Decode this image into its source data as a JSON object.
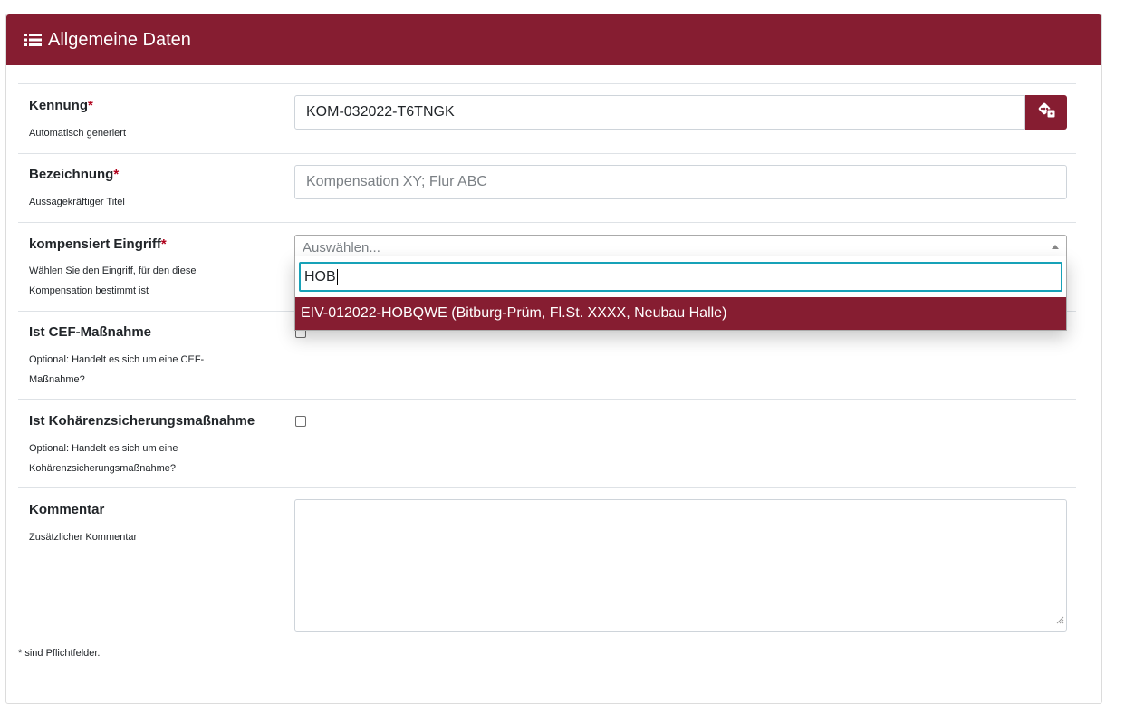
{
  "card": {
    "icon": "list-icon",
    "title": "Allgemeine Daten"
  },
  "fields": {
    "kennung": {
      "label": "Kennung",
      "required_mark": "*",
      "hint": "Automatisch generiert",
      "value": "KOM-032022-T6TNGK",
      "generate_icon": "dice-icon"
    },
    "bezeichnung": {
      "label": "Bezeichnung",
      "required_mark": "*",
      "hint": "Aussagekräftiger Titel",
      "placeholder": "Kompensation XY; Flur ABC"
    },
    "eingriff": {
      "label": "kompensiert Eingriff",
      "required_mark": "*",
      "hint_line1": "Wählen Sie den Eingriff, für den diese",
      "hint_line2": "Kompensation bestimmt ist",
      "select_placeholder": "Auswählen...",
      "search_value": "HOB",
      "options": [
        "EIV-012022-HOBQWE (Bitburg-Prüm, Fl.St. XXXX, Neubau Halle)"
      ]
    },
    "cef": {
      "label": "Ist CEF-Maßnahme",
      "hint_line1": "Optional: Handelt es sich um eine CEF-",
      "hint_line2": "Maßnahme?",
      "checked": false
    },
    "kohaerenz": {
      "label": "Ist Kohärenzsicherungsmaßnahme",
      "hint_line1": "Optional: Handelt es sich um eine",
      "hint_line2": "Kohärenzsicherungsmaßnahme?",
      "checked": false
    },
    "kommentar": {
      "label": "Kommentar",
      "hint": "Zusätzlicher Kommentar",
      "value": ""
    }
  },
  "footnote": "* sind Pflichtfelder.",
  "colors": {
    "brand": "#861d31",
    "focus": "#17a2b8"
  }
}
